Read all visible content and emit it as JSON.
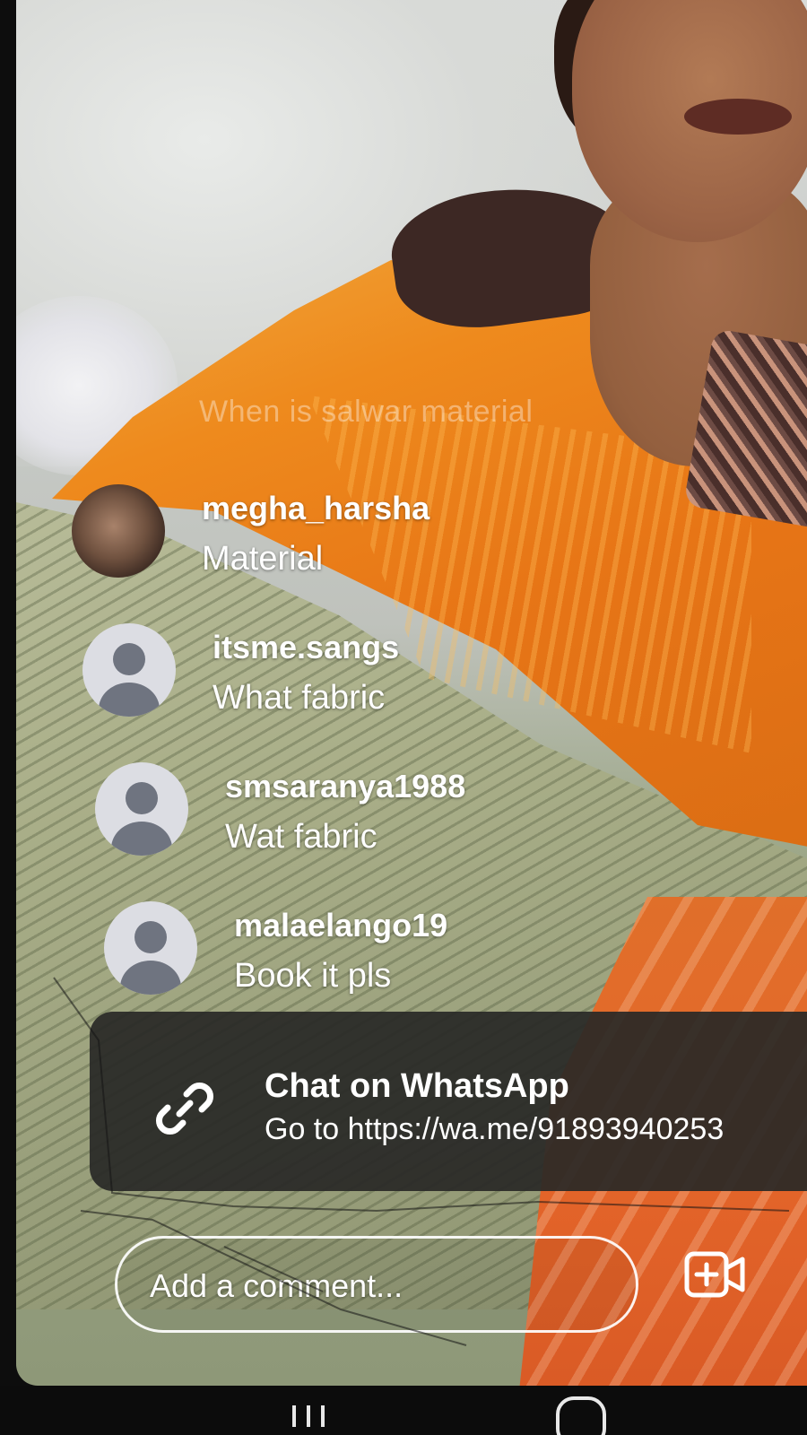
{
  "live": {
    "ghost_comment": "When is salwar material"
  },
  "comments": [
    {
      "username": "megha_harsha",
      "text": "Material",
      "avatar": "photo"
    },
    {
      "username": "itsme.sangs",
      "text": "What fabric",
      "avatar": "default-user-icon"
    },
    {
      "username": "smsaranya1988",
      "text": "Wat fabric",
      "avatar": "default-user-icon"
    },
    {
      "username": "malaelango19",
      "text": "Book it pls",
      "avatar": "default-user-icon"
    }
  ],
  "whatsapp_banner": {
    "title": "Chat on WhatsApp",
    "subtitle": "Go to https://wa.me/91893940253",
    "icon": "link-icon"
  },
  "input": {
    "placeholder": "Add a comment..."
  },
  "icons": {
    "video_add": "video-add-icon",
    "nav_recent": "recent-apps-icon",
    "nav_home": "home-icon"
  }
}
